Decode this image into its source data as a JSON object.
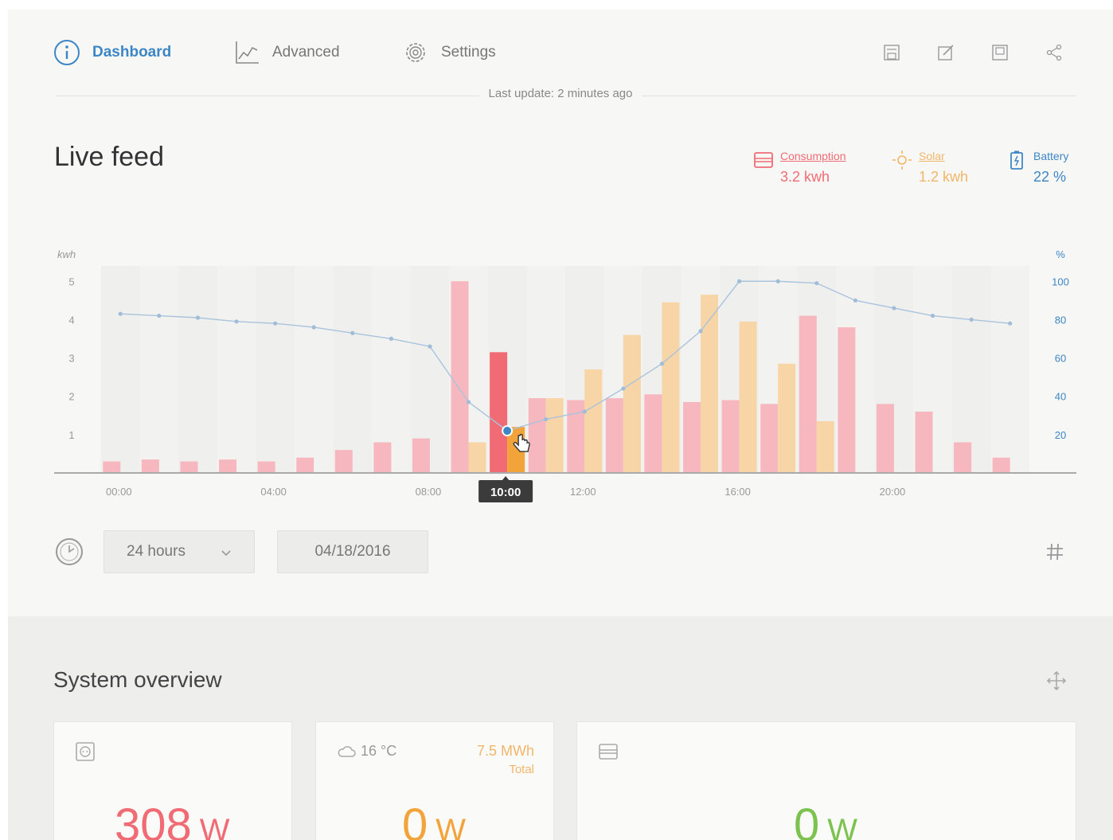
{
  "nav": {
    "tabs": [
      {
        "label": "Dashboard",
        "icon": "info-gauge-icon",
        "active": true
      },
      {
        "label": "Advanced",
        "icon": "line-chart-icon",
        "active": false
      },
      {
        "label": "Settings",
        "icon": "gear-icon",
        "active": false
      }
    ],
    "tools": [
      "save-icon",
      "edit-icon",
      "export-icon",
      "share-icon"
    ]
  },
  "last_update": "Last update: 2 minutes ago",
  "live_feed": {
    "title": "Live feed",
    "legend": [
      {
        "name": "Consumption",
        "value": "3.2 kwh",
        "color": "#f06b74",
        "icon": "meter-icon"
      },
      {
        "name": "Solar",
        "value": "1.2 kwh",
        "color": "#f2b66a",
        "icon": "sun-icon"
      },
      {
        "name": "Battery",
        "value": "22 %",
        "color": "#3d86c6",
        "icon": "battery-icon"
      }
    ]
  },
  "chart_data": {
    "type": "bar",
    "left_axis_label": "kwh",
    "right_axis_label": "%",
    "left_ticks": [
      1,
      2,
      3,
      4,
      5
    ],
    "right_ticks": [
      20,
      40,
      60,
      80,
      100
    ],
    "ylim_left": [
      0,
      5.4
    ],
    "ylim_right": [
      0,
      108
    ],
    "x_tick_labels": [
      "00:00",
      "04:00",
      "08:00",
      "10:00",
      "12:00",
      "16:00",
      "20:00"
    ],
    "x_tick_hours": [
      0,
      4,
      8,
      10,
      12,
      16,
      20
    ],
    "highlight_hour": 10,
    "highlight_label": "10:00",
    "hours": [
      0,
      1,
      2,
      3,
      4,
      5,
      6,
      7,
      8,
      9,
      10,
      11,
      12,
      13,
      14,
      15,
      16,
      17,
      18,
      19,
      20,
      21,
      22,
      23
    ],
    "series": [
      {
        "name": "Consumption",
        "color": "#f7b7bf",
        "values": [
          0.3,
          0.35,
          0.3,
          0.35,
          0.3,
          0.4,
          0.6,
          0.8,
          0.9,
          5.0,
          3.15,
          1.95,
          1.9,
          1.95,
          2.05,
          1.85,
          1.9,
          1.8,
          4.1,
          3.8,
          1.8,
          1.6,
          0.8,
          0.4
        ]
      },
      {
        "name": "Solar",
        "color": "#f8d5a6",
        "values": [
          0,
          0,
          0,
          0,
          0,
          0,
          0,
          0,
          0,
          0.8,
          1.2,
          1.95,
          2.7,
          3.6,
          4.45,
          4.65,
          3.95,
          2.85,
          1.35,
          0,
          0,
          0,
          0,
          0
        ]
      },
      {
        "name": "Battery",
        "color": "#a9c3dd",
        "values": [
          83,
          82,
          81,
          79,
          78,
          76,
          73,
          70,
          66,
          37,
          22,
          28,
          32,
          44,
          57,
          74,
          100,
          100,
          99,
          90,
          86,
          82,
          80,
          78
        ]
      }
    ],
    "highlight_colors": {
      "consumption": "#f06b74",
      "solar": "#f2a33a",
      "battery_point": "#3d86c6"
    }
  },
  "controls": {
    "range_value": "24 hours",
    "date_value": "04/18/2016"
  },
  "overview": {
    "title": "System overview",
    "cards": [
      {
        "icon": "socket-icon",
        "value": "308",
        "unit": "W",
        "color": "#f06b74"
      },
      {
        "icon": "cloud-icon",
        "temperature": "16 °C",
        "total_value": "7.5 MWh",
        "total_label": "Total",
        "value": "0",
        "unit": "W",
        "color": "#f2a33a"
      },
      {
        "icon": "meter-icon",
        "value": "0",
        "unit": "W",
        "color": "#7cc24f"
      }
    ]
  }
}
